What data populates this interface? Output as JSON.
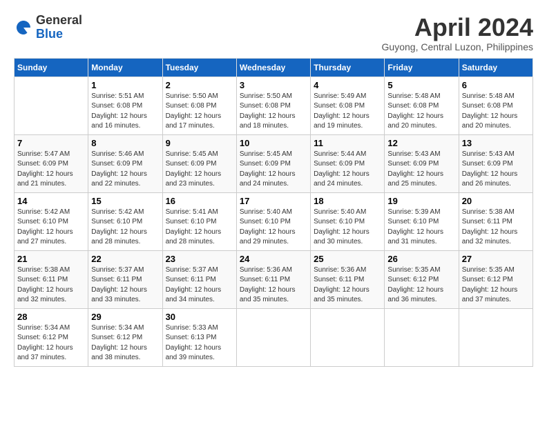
{
  "header": {
    "logo_general": "General",
    "logo_blue": "Blue",
    "month_title": "April 2024",
    "location": "Guyong, Central Luzon, Philippines"
  },
  "columns": [
    "Sunday",
    "Monday",
    "Tuesday",
    "Wednesday",
    "Thursday",
    "Friday",
    "Saturday"
  ],
  "weeks": [
    [
      {
        "day": "",
        "sunrise": "",
        "sunset": "",
        "daylight": ""
      },
      {
        "day": "1",
        "sunrise": "Sunrise: 5:51 AM",
        "sunset": "Sunset: 6:08 PM",
        "daylight": "Daylight: 12 hours and 16 minutes."
      },
      {
        "day": "2",
        "sunrise": "Sunrise: 5:50 AM",
        "sunset": "Sunset: 6:08 PM",
        "daylight": "Daylight: 12 hours and 17 minutes."
      },
      {
        "day": "3",
        "sunrise": "Sunrise: 5:50 AM",
        "sunset": "Sunset: 6:08 PM",
        "daylight": "Daylight: 12 hours and 18 minutes."
      },
      {
        "day": "4",
        "sunrise": "Sunrise: 5:49 AM",
        "sunset": "Sunset: 6:08 PM",
        "daylight": "Daylight: 12 hours and 19 minutes."
      },
      {
        "day": "5",
        "sunrise": "Sunrise: 5:48 AM",
        "sunset": "Sunset: 6:08 PM",
        "daylight": "Daylight: 12 hours and 20 minutes."
      },
      {
        "day": "6",
        "sunrise": "Sunrise: 5:48 AM",
        "sunset": "Sunset: 6:08 PM",
        "daylight": "Daylight: 12 hours and 20 minutes."
      }
    ],
    [
      {
        "day": "7",
        "sunrise": "Sunrise: 5:47 AM",
        "sunset": "Sunset: 6:09 PM",
        "daylight": "Daylight: 12 hours and 21 minutes."
      },
      {
        "day": "8",
        "sunrise": "Sunrise: 5:46 AM",
        "sunset": "Sunset: 6:09 PM",
        "daylight": "Daylight: 12 hours and 22 minutes."
      },
      {
        "day": "9",
        "sunrise": "Sunrise: 5:45 AM",
        "sunset": "Sunset: 6:09 PM",
        "daylight": "Daylight: 12 hours and 23 minutes."
      },
      {
        "day": "10",
        "sunrise": "Sunrise: 5:45 AM",
        "sunset": "Sunset: 6:09 PM",
        "daylight": "Daylight: 12 hours and 24 minutes."
      },
      {
        "day": "11",
        "sunrise": "Sunrise: 5:44 AM",
        "sunset": "Sunset: 6:09 PM",
        "daylight": "Daylight: 12 hours and 24 minutes."
      },
      {
        "day": "12",
        "sunrise": "Sunrise: 5:43 AM",
        "sunset": "Sunset: 6:09 PM",
        "daylight": "Daylight: 12 hours and 25 minutes."
      },
      {
        "day": "13",
        "sunrise": "Sunrise: 5:43 AM",
        "sunset": "Sunset: 6:09 PM",
        "daylight": "Daylight: 12 hours and 26 minutes."
      }
    ],
    [
      {
        "day": "14",
        "sunrise": "Sunrise: 5:42 AM",
        "sunset": "Sunset: 6:10 PM",
        "daylight": "Daylight: 12 hours and 27 minutes."
      },
      {
        "day": "15",
        "sunrise": "Sunrise: 5:42 AM",
        "sunset": "Sunset: 6:10 PM",
        "daylight": "Daylight: 12 hours and 28 minutes."
      },
      {
        "day": "16",
        "sunrise": "Sunrise: 5:41 AM",
        "sunset": "Sunset: 6:10 PM",
        "daylight": "Daylight: 12 hours and 28 minutes."
      },
      {
        "day": "17",
        "sunrise": "Sunrise: 5:40 AM",
        "sunset": "Sunset: 6:10 PM",
        "daylight": "Daylight: 12 hours and 29 minutes."
      },
      {
        "day": "18",
        "sunrise": "Sunrise: 5:40 AM",
        "sunset": "Sunset: 6:10 PM",
        "daylight": "Daylight: 12 hours and 30 minutes."
      },
      {
        "day": "19",
        "sunrise": "Sunrise: 5:39 AM",
        "sunset": "Sunset: 6:10 PM",
        "daylight": "Daylight: 12 hours and 31 minutes."
      },
      {
        "day": "20",
        "sunrise": "Sunrise: 5:38 AM",
        "sunset": "Sunset: 6:11 PM",
        "daylight": "Daylight: 12 hours and 32 minutes."
      }
    ],
    [
      {
        "day": "21",
        "sunrise": "Sunrise: 5:38 AM",
        "sunset": "Sunset: 6:11 PM",
        "daylight": "Daylight: 12 hours and 32 minutes."
      },
      {
        "day": "22",
        "sunrise": "Sunrise: 5:37 AM",
        "sunset": "Sunset: 6:11 PM",
        "daylight": "Daylight: 12 hours and 33 minutes."
      },
      {
        "day": "23",
        "sunrise": "Sunrise: 5:37 AM",
        "sunset": "Sunset: 6:11 PM",
        "daylight": "Daylight: 12 hours and 34 minutes."
      },
      {
        "day": "24",
        "sunrise": "Sunrise: 5:36 AM",
        "sunset": "Sunset: 6:11 PM",
        "daylight": "Daylight: 12 hours and 35 minutes."
      },
      {
        "day": "25",
        "sunrise": "Sunrise: 5:36 AM",
        "sunset": "Sunset: 6:11 PM",
        "daylight": "Daylight: 12 hours and 35 minutes."
      },
      {
        "day": "26",
        "sunrise": "Sunrise: 5:35 AM",
        "sunset": "Sunset: 6:12 PM",
        "daylight": "Daylight: 12 hours and 36 minutes."
      },
      {
        "day": "27",
        "sunrise": "Sunrise: 5:35 AM",
        "sunset": "Sunset: 6:12 PM",
        "daylight": "Daylight: 12 hours and 37 minutes."
      }
    ],
    [
      {
        "day": "28",
        "sunrise": "Sunrise: 5:34 AM",
        "sunset": "Sunset: 6:12 PM",
        "daylight": "Daylight: 12 hours and 37 minutes."
      },
      {
        "day": "29",
        "sunrise": "Sunrise: 5:34 AM",
        "sunset": "Sunset: 6:12 PM",
        "daylight": "Daylight: 12 hours and 38 minutes."
      },
      {
        "day": "30",
        "sunrise": "Sunrise: 5:33 AM",
        "sunset": "Sunset: 6:13 PM",
        "daylight": "Daylight: 12 hours and 39 minutes."
      },
      {
        "day": "",
        "sunrise": "",
        "sunset": "",
        "daylight": ""
      },
      {
        "day": "",
        "sunrise": "",
        "sunset": "",
        "daylight": ""
      },
      {
        "day": "",
        "sunrise": "",
        "sunset": "",
        "daylight": ""
      },
      {
        "day": "",
        "sunrise": "",
        "sunset": "",
        "daylight": ""
      }
    ]
  ]
}
